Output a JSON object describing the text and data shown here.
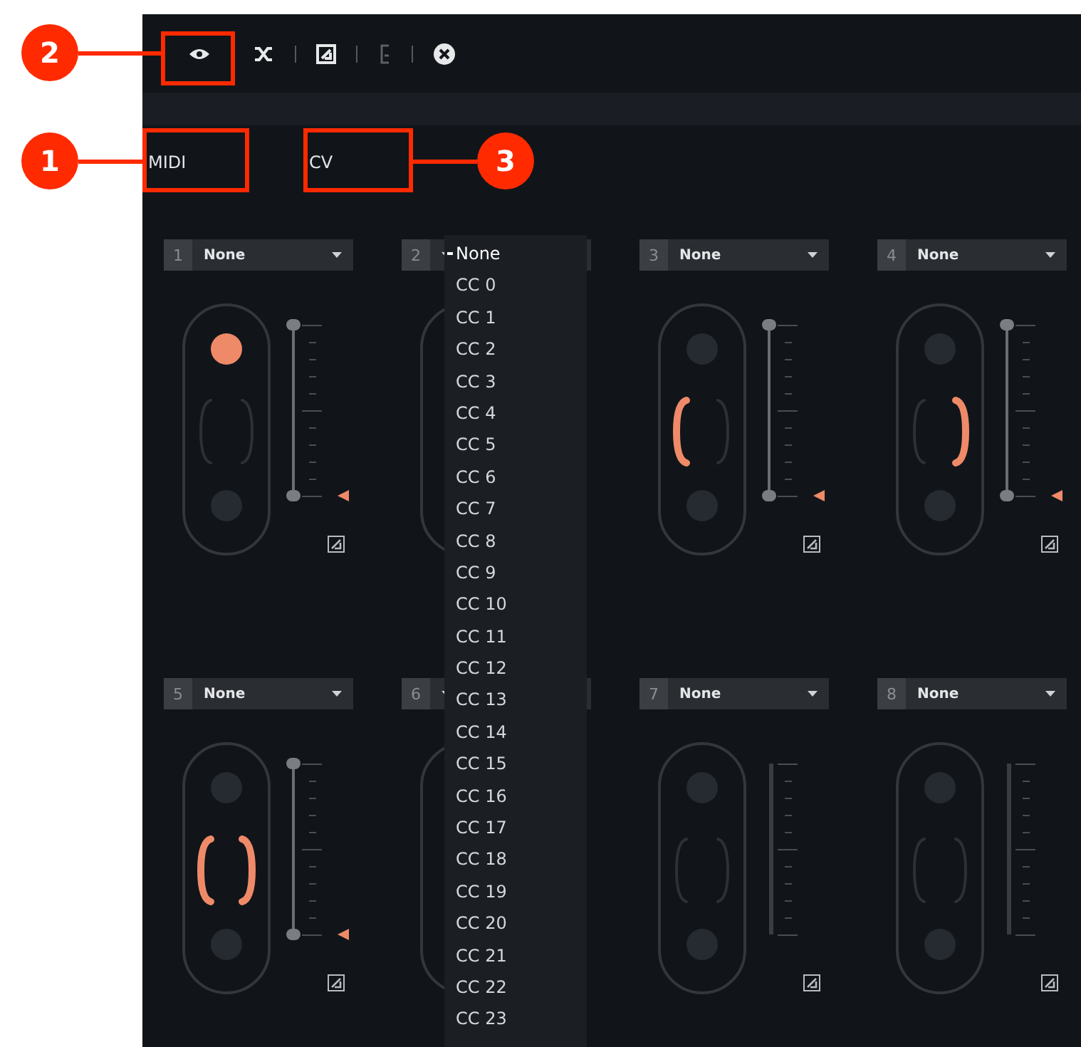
{
  "toolbar": [
    {
      "kind": "eye",
      "disabled": false
    },
    {
      "kind": "shuffle",
      "disabled": false
    },
    {
      "kind": "resize",
      "disabled": false
    },
    {
      "kind": "bracket",
      "disabled": true
    },
    {
      "kind": "close",
      "disabled": false
    }
  ],
  "tabs": [
    {
      "label": "MIDI"
    },
    {
      "label": "CV"
    }
  ],
  "slots": [
    {
      "number": "1",
      "value": "None",
      "dot_lit": true,
      "left_lit": false,
      "right_lit": false,
      "active": true
    },
    {
      "number": "2"
    },
    {
      "number": "3",
      "value": "None",
      "dot_lit": false,
      "left_lit": true,
      "right_lit": false,
      "active": true
    },
    {
      "number": "4",
      "value": "None",
      "dot_lit": false,
      "left_lit": false,
      "right_lit": true,
      "active": true
    },
    {
      "number": "5",
      "value": "None",
      "dot_lit": false,
      "left_lit": true,
      "right_lit": true,
      "active": true
    },
    {
      "number": "6"
    },
    {
      "number": "7",
      "value": "None",
      "dot_lit": false,
      "left_lit": false,
      "right_lit": false,
      "active": false
    },
    {
      "number": "8",
      "value": "None",
      "dot_lit": false,
      "left_lit": false,
      "right_lit": false,
      "active": false
    }
  ],
  "dropdown": {
    "items": [
      {
        "label": "None",
        "selected": true
      },
      {
        "label": "CC 0",
        "selected": false
      },
      {
        "label": "CC 1",
        "selected": false
      },
      {
        "label": "CC 2",
        "selected": false
      },
      {
        "label": "CC 3",
        "selected": false
      },
      {
        "label": "CC 4",
        "selected": false
      },
      {
        "label": "CC 5",
        "selected": false
      },
      {
        "label": "CC 6",
        "selected": false
      },
      {
        "label": "CC 7",
        "selected": false
      },
      {
        "label": "CC 8",
        "selected": false
      },
      {
        "label": "CC 9",
        "selected": false
      },
      {
        "label": "CC 10",
        "selected": false
      },
      {
        "label": "CC 11",
        "selected": false
      },
      {
        "label": "CC 12",
        "selected": false
      },
      {
        "label": "CC 13",
        "selected": false
      },
      {
        "label": "CC 14",
        "selected": false
      },
      {
        "label": "CC 15",
        "selected": false
      },
      {
        "label": "CC 16",
        "selected": false
      },
      {
        "label": "CC 17",
        "selected": false
      },
      {
        "label": "CC 18",
        "selected": false
      },
      {
        "label": "CC 19",
        "selected": false
      },
      {
        "label": "CC 20",
        "selected": false
      },
      {
        "label": "CC 21",
        "selected": false
      },
      {
        "label": "CC 22",
        "selected": false
      },
      {
        "label": "CC 23",
        "selected": false
      }
    ]
  },
  "annotations": [
    {
      "number": "2"
    },
    {
      "number": "1"
    },
    {
      "number": "3"
    }
  ]
}
